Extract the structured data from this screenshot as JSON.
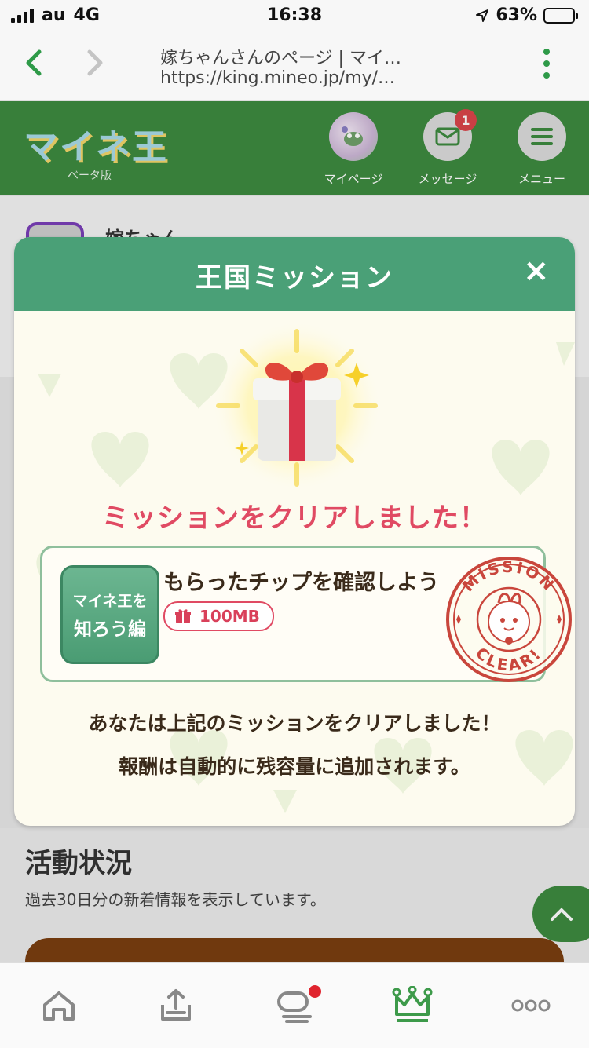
{
  "status_bar": {
    "carrier": "au",
    "network": "4G",
    "time": "16:38",
    "battery": "63%",
    "battery_level": 0.63
  },
  "browser": {
    "back_icon": "chevron-left-icon",
    "forward_icon": "chevron-right-icon",
    "title": "嫁ちゃんさんのページ | マイ…",
    "url": "https://king.mineo.jp/my/…",
    "menu_icon": "kebab-menu-icon"
  },
  "site_header": {
    "logo": "マイネ王",
    "logo_sub": "ベータ版",
    "items": [
      {
        "label": "マイページ",
        "icon": "avatar"
      },
      {
        "label": "メッセージ",
        "icon": "mail-icon",
        "badge": "1"
      },
      {
        "label": "メニュー",
        "icon": "hamburger-menu-icon"
      }
    ]
  },
  "profile": {
    "name": "嫁ちゃん"
  },
  "modal": {
    "title": "王国ミッション",
    "close_label": "×",
    "clear_message": "ミッションをクリアしました！",
    "mission": {
      "badge_line1": "マイネ王を",
      "badge_line2": "知ろう編",
      "name": "もらったチップを確認しよう",
      "reward": "100MB"
    },
    "stamp": {
      "top_text": "MISSION",
      "bottom_text": "CLEAR!"
    },
    "info_line1": "あなたは上記のミッションをクリアしました！",
    "info_line2": "報酬は自動的に残容量に追加されます。"
  },
  "activity": {
    "title": "活動状況",
    "subtitle": "過去30日分の新着情報を表示しています。"
  },
  "tabbar": {
    "items": [
      "home-icon",
      "upload-icon",
      "chat-icon",
      "crown-icon",
      "more-icon"
    ],
    "active": "crown-icon"
  },
  "colors": {
    "brand_green": "#3d8a3f",
    "modal_green": "#4aa077",
    "accent_red": "#e04a63"
  }
}
